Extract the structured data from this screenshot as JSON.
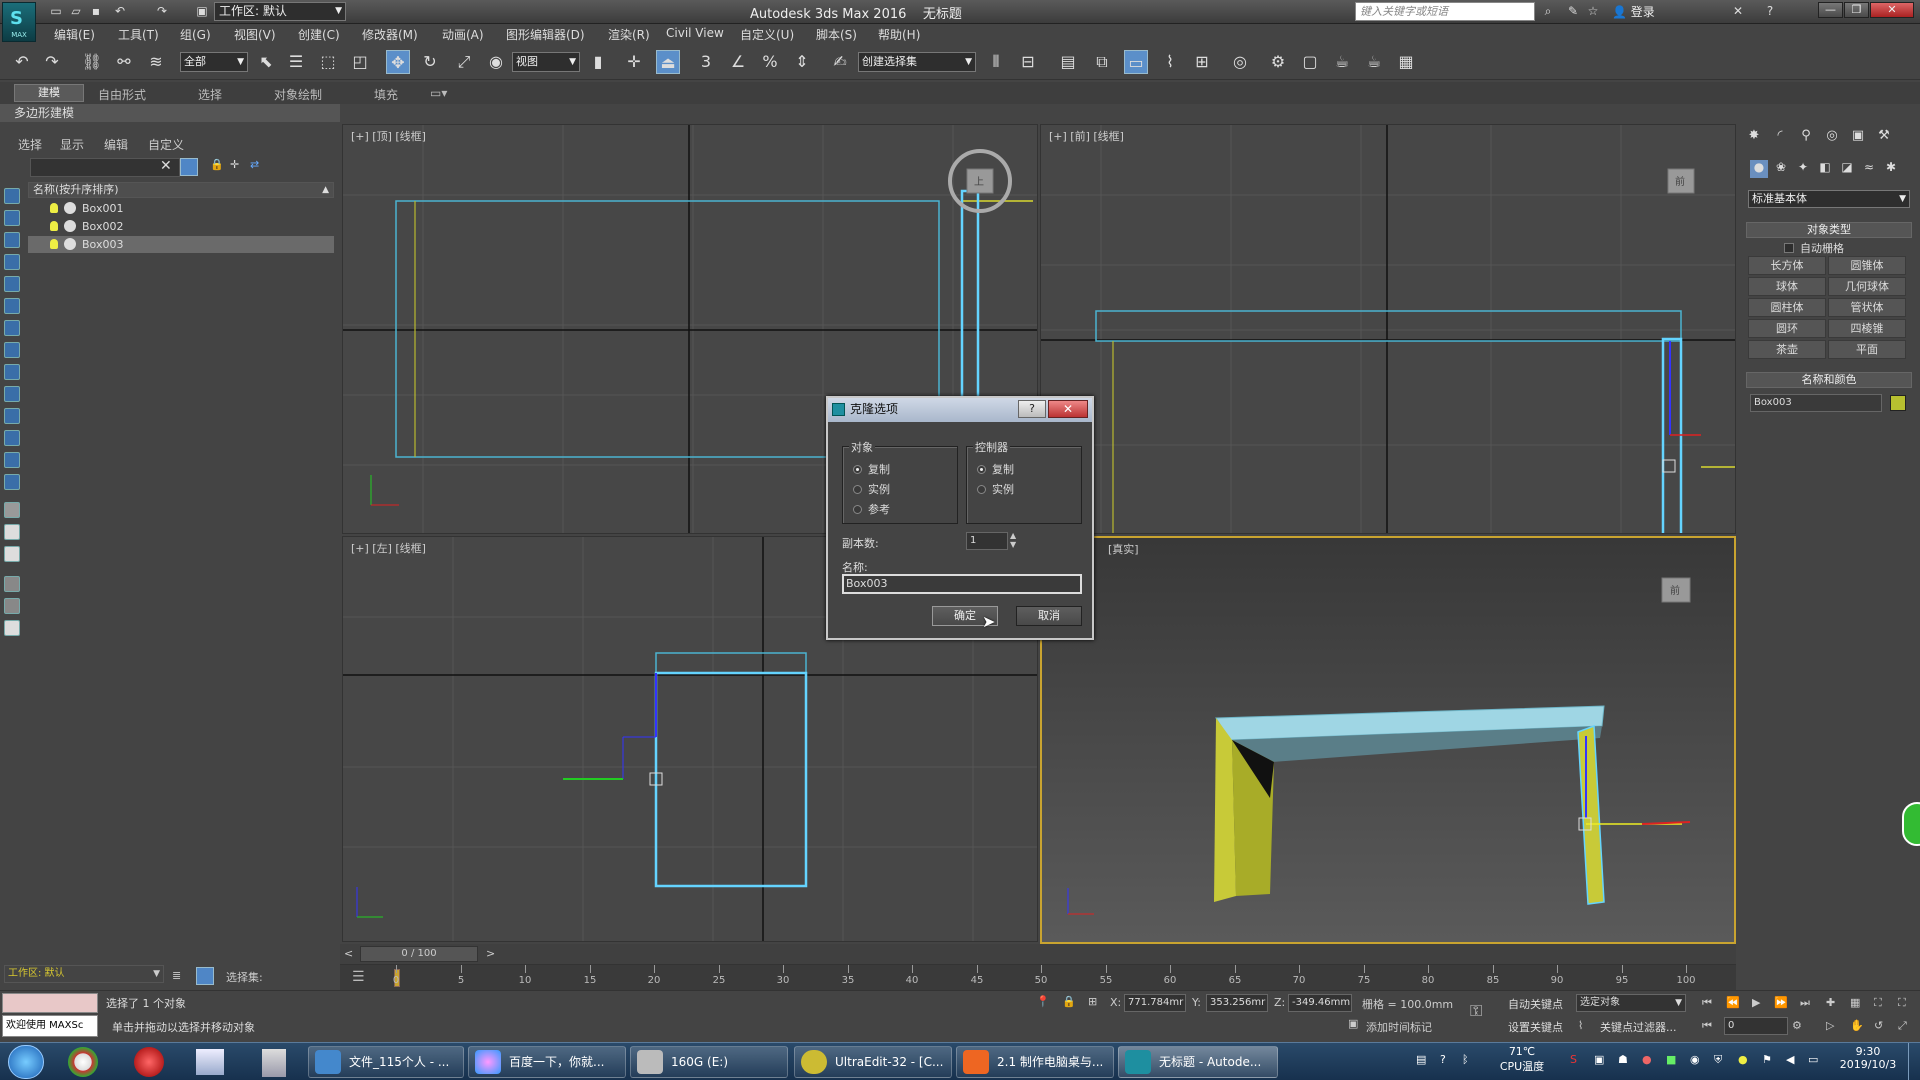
{
  "app": {
    "logo_text": "MAX",
    "title": "Autodesk 3ds Max 2016",
    "doc": "无标题",
    "workspace": "工作区: 默认",
    "search_placeholder": "键入关键字或短语",
    "login": "登录"
  },
  "menus": [
    "编辑(E)",
    "工具(T)",
    "组(G)",
    "视图(V)",
    "创建(C)",
    "修改器(M)",
    "动画(A)",
    "图形编辑器(D)",
    "渲染(R)",
    "Civil View",
    "自定义(U)",
    "脚本(S)",
    "帮助(H)"
  ],
  "toolbar": {
    "filter": "全部",
    "ref_coord": "视图",
    "selection_set": "创建选择集",
    "snap3": "3",
    "snap_pct": "%"
  },
  "ribbon": {
    "tabs": [
      "建模",
      "自由形式",
      "选择",
      "对象绘制",
      "填充"
    ],
    "panel": "多边形建模"
  },
  "scene": {
    "tabs": [
      "选择",
      "显示",
      "编辑",
      "自定义"
    ],
    "header": "名称(按升序排序)",
    "objects": [
      "Box001",
      "Box002",
      "Box003"
    ],
    "selected": "Box003"
  },
  "viewports": {
    "top": "[+] [顶] [线框]",
    "front": "[+] [前] [线框]",
    "left": "[+] [左] [线框]",
    "persp": "[真实]",
    "cube_top": "上",
    "cube_front": "前",
    "cube_persp": "前"
  },
  "dialog": {
    "title": "克隆选项",
    "help": "?",
    "close": "✕",
    "group_object": "对象",
    "group_controller": "控制器",
    "opt_copy": "复制",
    "opt_instance": "实例",
    "opt_reference": "参考",
    "copies_label": "副本数:",
    "copies": "1",
    "name_label": "名称:",
    "name_value": "Box003",
    "ok": "确定",
    "cancel": "取消"
  },
  "command_panel": {
    "category": "标准基本体",
    "rollout_type": "对象类型",
    "autogrid": "自动栅格",
    "objects": [
      "长方体",
      "圆锥体",
      "球体",
      "几何球体",
      "圆柱体",
      "管状体",
      "圆环",
      "四棱锥",
      "茶壶",
      "平面"
    ],
    "rollout_name": "名称和颜色",
    "name_value": "Box003",
    "color": "#b8c030"
  },
  "timeline": {
    "frame": "0 / 100",
    "ticks": [
      "0",
      "5",
      "10",
      "15",
      "20",
      "25",
      "30",
      "35",
      "40",
      "45",
      "50",
      "55",
      "60",
      "65",
      "70",
      "75",
      "80",
      "85",
      "90",
      "95",
      "100"
    ]
  },
  "status": {
    "workspace": "工作区: 默认",
    "selection_set_label": "选择集:",
    "welcome": "欢迎使用 MAXSc",
    "selected_msg": "选择了 1 个对象",
    "hint": "单击并拖动以选择并移动对象",
    "x_label": "X:",
    "x": "771.784mr",
    "y_label": "Y:",
    "y": "353.256mr",
    "z_label": "Z:",
    "z": "-349.46mm",
    "grid": "栅格 = 100.0mm",
    "auto_key": "自动关键点",
    "set_key": "设置关键点",
    "key_target": "选定对象",
    "key_filters": "关键点过滤器...",
    "add_time_tag": "添加时间标记",
    "frame_field": "0"
  },
  "taskbar": {
    "items": [
      "文件_115个人 - ...",
      "百度一下，你就...",
      "160G (E:)",
      "UltraEdit-32 - [C...",
      "2.1 制作电脑桌与...",
      "无标题 - Autode..."
    ],
    "temp": "71℃",
    "cpu": "CPU温度",
    "time": "9:30",
    "date": "2019/10/3"
  }
}
